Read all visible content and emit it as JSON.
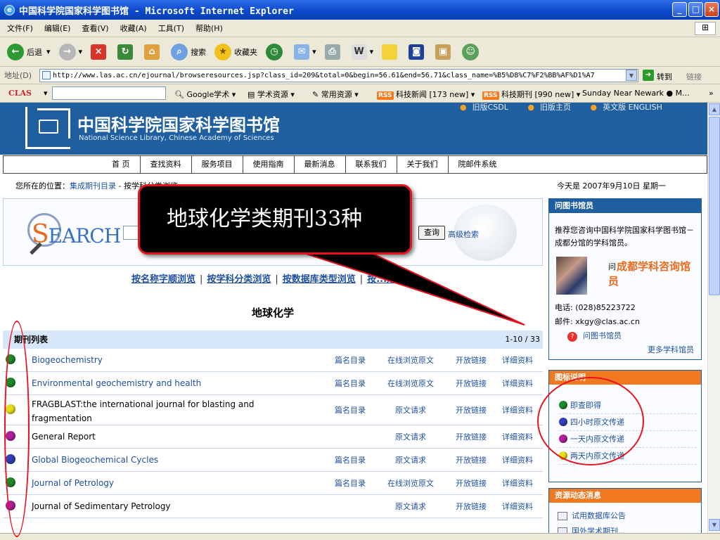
{
  "window": {
    "title": "中国科学院国家科学图书馆 - Microsoft Internet Explorer",
    "buttons": {
      "min": "_",
      "max": "□",
      "close": "×"
    }
  },
  "menu": [
    "文件(F)",
    "编辑(E)",
    "查看(V)",
    "收藏(A)",
    "工具(T)",
    "帮助(H)"
  ],
  "toolbar": {
    "back": "后退",
    "search": "搜索",
    "favorites": "收藏夹"
  },
  "address": {
    "label": "地址(D)",
    "url": "http://www.las.ac.cn/ejournal/browseresources.jsp?class_id=209&total=0&begin=56.61&end=56.71&class_name=%B5%D8%C7%F2%BB%AF%D1%A7",
    "go": "转到",
    "links": "链接"
  },
  "clasbar": {
    "brand": "CLAS",
    "google": "Google学术",
    "academic": "学术资源",
    "common": "常用资源",
    "rss": "RSS",
    "scinews": "科技新闻 [173 new]",
    "journals": "科技期刊 [990 new]",
    "weather": "Sunday Near Newark ● M..."
  },
  "site": {
    "title": "中国科学院国家科学图书馆",
    "subtitle": "National Science Library, Chinese Academy of Sciences",
    "toplinks": [
      "旧版CSDL",
      "旧版主页",
      "英文版 ENGLISH"
    ],
    "nav": [
      "首 页",
      "查找资料",
      "服务项目",
      "使用指南",
      "最新消息",
      "联系我们",
      "关于我们",
      "院邮件系统"
    ],
    "crumb_label": "您所在的位置：",
    "crumb_link": "集成期刊目录",
    "crumb_rest": " - 按学科分类浏览",
    "today": "今天是 2007年9月10日 星期一"
  },
  "search": {
    "logo_s": "S",
    "logo_rest": "EARCH",
    "query_button": "查询",
    "advanced": "高级检索"
  },
  "browse": {
    "by_name": "按名称字顺浏览",
    "by_subject": "按学科分类浏览",
    "by_dbtype": "按数据库类型浏览",
    "by_last": "按...期浏览"
  },
  "subject_title": "地球化学",
  "list": {
    "header": "期刊列表",
    "count": "1-10 / 33",
    "rows": [
      {
        "name": "Biogeochemistry",
        "color": "#1f8a2a",
        "toc": "篇名目录",
        "full": "在线浏览原文",
        "open": "开放链接",
        "detail": "详细资料",
        "link": true
      },
      {
        "name": "Environmental geochemistry and health",
        "color": "#1f8a2a",
        "toc": "篇名目录",
        "full": "在线浏览原文",
        "open": "开放链接",
        "detail": "详细资料",
        "link": true
      },
      {
        "name": "FRAGBLAST:the international journal for blasting and fragmentation",
        "color": "#e6df1a",
        "toc": "篇名目录",
        "full": "原文请求",
        "open": "开放链接",
        "detail": "详细资料",
        "link": false
      },
      {
        "name": "General Report",
        "color": "#b0209a",
        "toc": "",
        "full": "原文请求",
        "open": "开放链接",
        "detail": "详细资料",
        "link": false
      },
      {
        "name": "Global Biogeochemical Cycles",
        "color": "#3340b8",
        "toc": "篇名目录",
        "full": "原文请求",
        "open": "开放链接",
        "detail": "详细资料",
        "link": true
      },
      {
        "name": "Journal of Petrology",
        "color": "#1f8a2a",
        "toc": "篇名目录",
        "full": "在线浏览原文",
        "open": "开放链接",
        "detail": "详细资料",
        "link": true
      },
      {
        "name": "Journal of Sedimentary Petrology",
        "color": "#b0209a",
        "toc": "",
        "full": "原文请求",
        "open": "开放链接",
        "detail": "详细资料",
        "link": false
      }
    ]
  },
  "ask": {
    "header": "问图书馆员",
    "text": "推荐您咨询中国科学院国家科学图书馆－成都分馆的学科馆员。",
    "q": "问",
    "name": "成都学科咨询馆员",
    "phone": "电话: (028)85223722",
    "mail": "邮件: xkgy@clas.ac.cn",
    "link": "问图书馆员",
    "more": "更多学科馆员"
  },
  "legend": {
    "header": "图标说明",
    "items": [
      {
        "label": "即查即得",
        "color": "#1f8a2a"
      },
      {
        "label": "四小时原文传递",
        "color": "#3340b8"
      },
      {
        "label": "一天内原文传递",
        "color": "#b0209a"
      },
      {
        "label": "两天内原文传递",
        "color": "#e6df1a"
      }
    ]
  },
  "news": {
    "header": "资源动态消息",
    "items": [
      "试用数据库公告",
      "国外学术期刊..."
    ]
  },
  "callout": {
    "text": "地球化学类期刊33种"
  }
}
